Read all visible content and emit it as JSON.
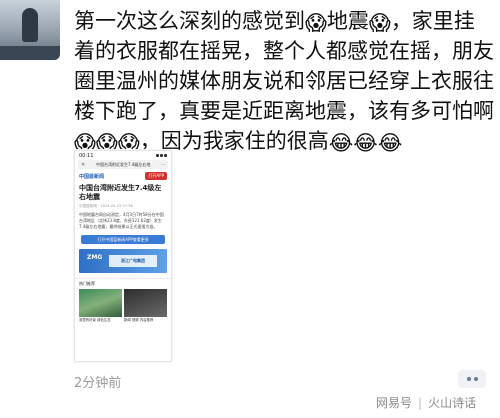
{
  "post": {
    "segments": [
      {
        "type": "text",
        "value": "第一次这么深刻的感觉到"
      },
      {
        "type": "emoji",
        "value": "😱"
      },
      {
        "type": "text",
        "value": "地震"
      },
      {
        "type": "emoji",
        "value": "😱"
      },
      {
        "type": "text",
        "value": "，家里挂着的衣服都在摇晃，整个人都感觉在摇，朋友圈里温州的媒体朋友说和邻居已经穿上衣服往楼下跑了，真要是近距离地震，该有多可怕啊"
      },
      {
        "type": "emoji",
        "value": "😱"
      },
      {
        "type": "emoji",
        "value": "😱"
      },
      {
        "type": "emoji",
        "value": "😱"
      },
      {
        "type": "text",
        "value": "，因为我家住的很高"
      },
      {
        "type": "emoji",
        "value": "😂"
      },
      {
        "type": "emoji",
        "value": "😂"
      },
      {
        "type": "emoji",
        "value": "😂"
      }
    ],
    "time": "2分钟前"
  },
  "screenshot": {
    "status_time": "00:11",
    "url": "中国台湾附近发生7.4级左右地",
    "close_glyph": "✕",
    "brand": "中国蓝新闻",
    "open_app": "打开APP",
    "headline": "中国台湾附近发生7.4级左右地震",
    "source": "中国蓝新闻 · 2024-04-03 07:58",
    "body": "中国地震台网自动测定，4月3日7时58分在中国台湾地区（北纬23.8度，东经121.62度）发生7.4级左右地震，最终结果以正式速报为准。",
    "blue_button": "打开中国蓝新闻APP查看更多",
    "banner_logo": "ZMG",
    "banner_slogan": "浙江广电集团",
    "hot_title": "热门推荐",
    "captions": [
      "浙里有好景 绿色生态",
      "新闻 视频 内容推荐"
    ]
  },
  "watermark": {
    "left": "网易号",
    "right": "火山诗话"
  }
}
